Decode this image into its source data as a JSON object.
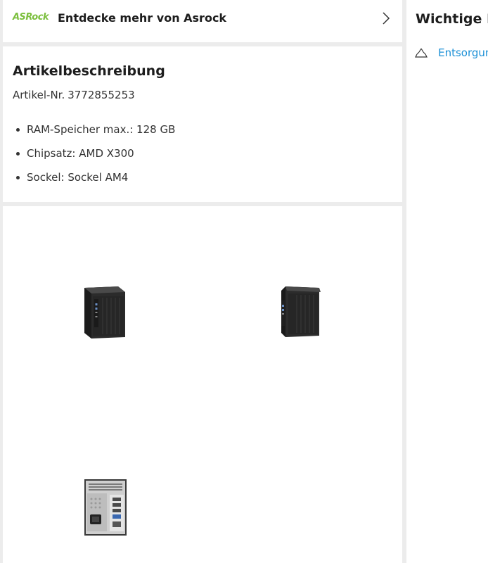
{
  "brand": {
    "logo_text": "ASRock",
    "link_text": "Entdecke mehr von Asrock",
    "chevron_icon": "chevron-right-icon"
  },
  "description": {
    "title": "Artikelbeschreibung",
    "article_label": "Artikel-Nr.",
    "article_number": "3772855253",
    "features": [
      "RAM-Speicher max.: 128 GB",
      "Chipsatz: AMD X300",
      "Sockel: Sockel AM4"
    ]
  },
  "gallery": {
    "images": [
      {
        "icon": "mini-pc-front-image"
      },
      {
        "icon": "mini-pc-angle-image"
      },
      {
        "icon": "mini-pc-rear-image"
      }
    ]
  },
  "side": {
    "title": "Wichtige Informationen",
    "link_text": "Entsorgung",
    "link_icon": "recycle-icon",
    "link_color": "#1a8fd6"
  },
  "colors": {
    "brand_green": "#7bbf3d",
    "page_bg": "#ececec"
  }
}
